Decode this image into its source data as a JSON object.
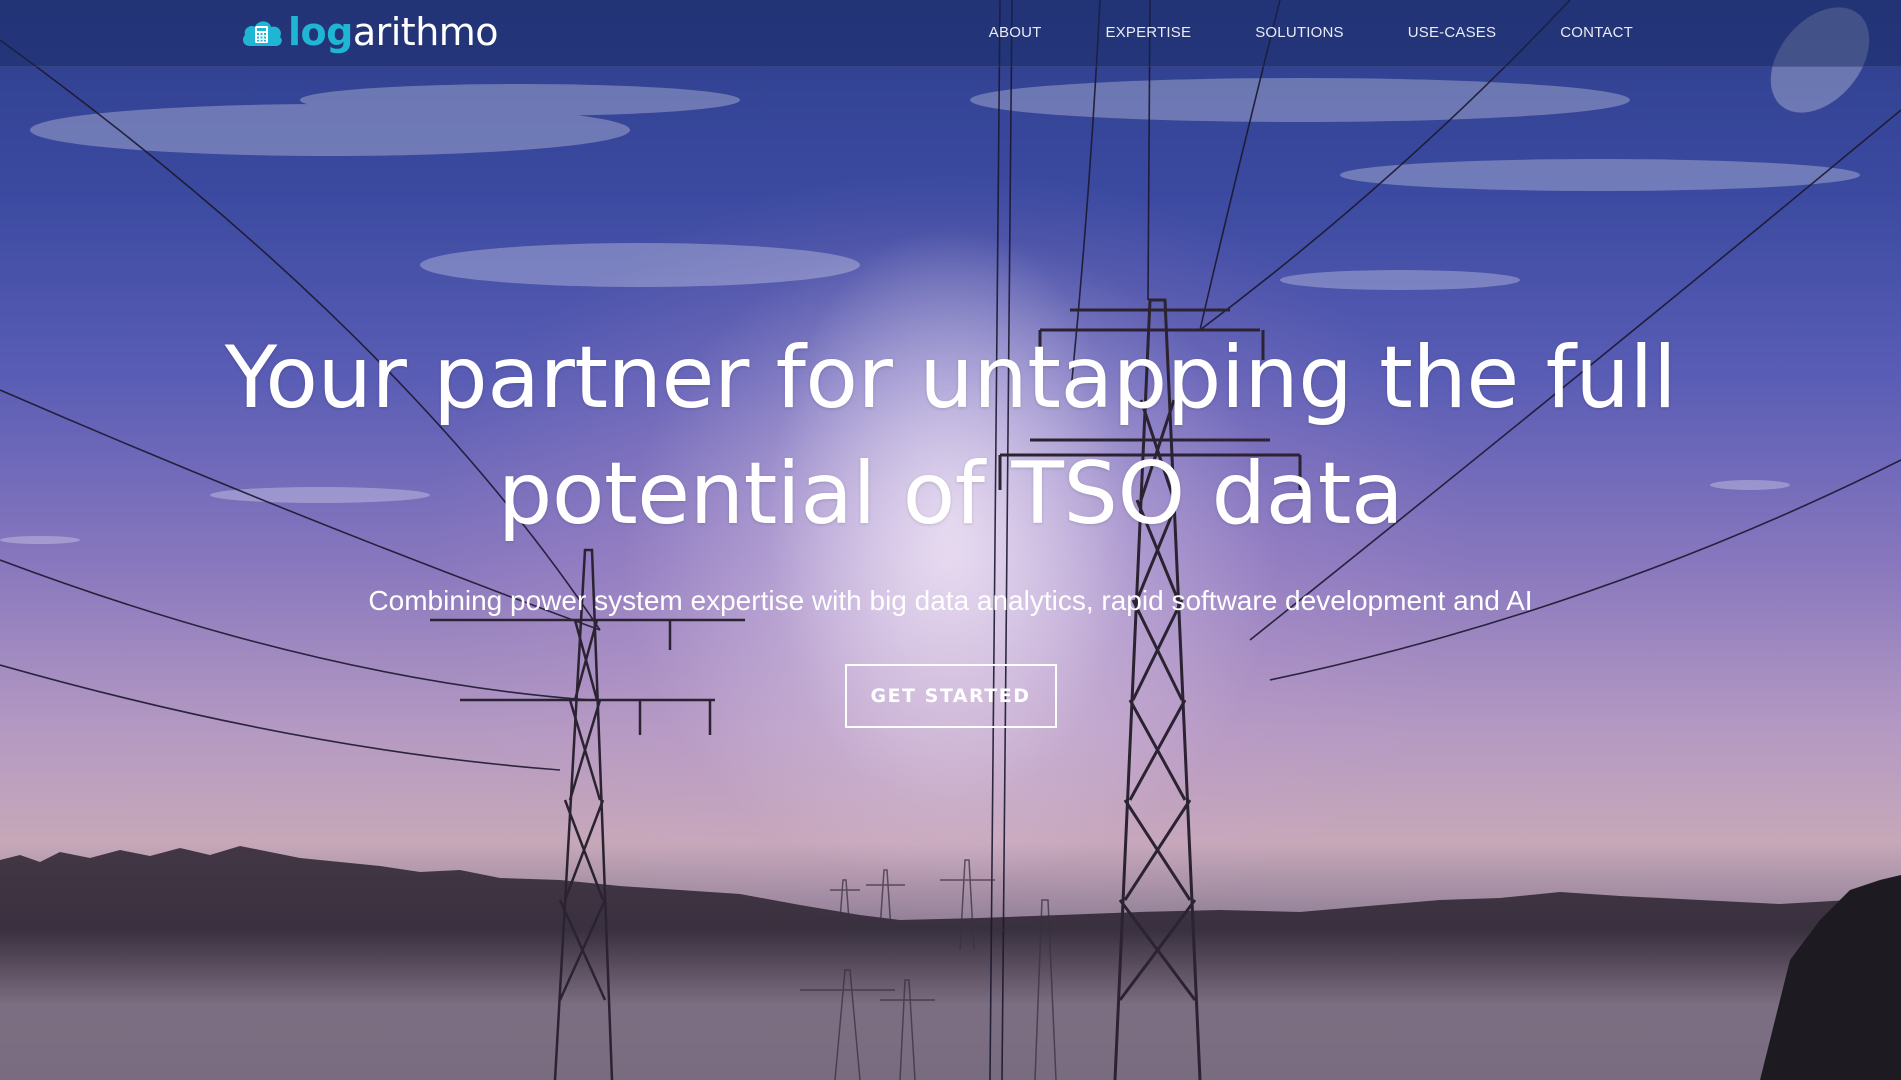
{
  "brand": {
    "logo_accent": "log",
    "logo_rest": "arithmo",
    "accent_color": "#1fb5d4",
    "icon": "cloud-calculator-icon"
  },
  "nav": {
    "items": [
      {
        "label": "ABOUT"
      },
      {
        "label": "EXPERTISE"
      },
      {
        "label": "SOLUTIONS"
      },
      {
        "label": "USE-CASES"
      },
      {
        "label": "CONTACT"
      }
    ]
  },
  "hero": {
    "title": "Your partner for untapping the full potential of TSO data",
    "subtitle": "Combining power system expertise with big data analytics, rapid software development and AI",
    "cta_label": "GET STARTED",
    "background": "power-lines-sunrise-photo"
  }
}
